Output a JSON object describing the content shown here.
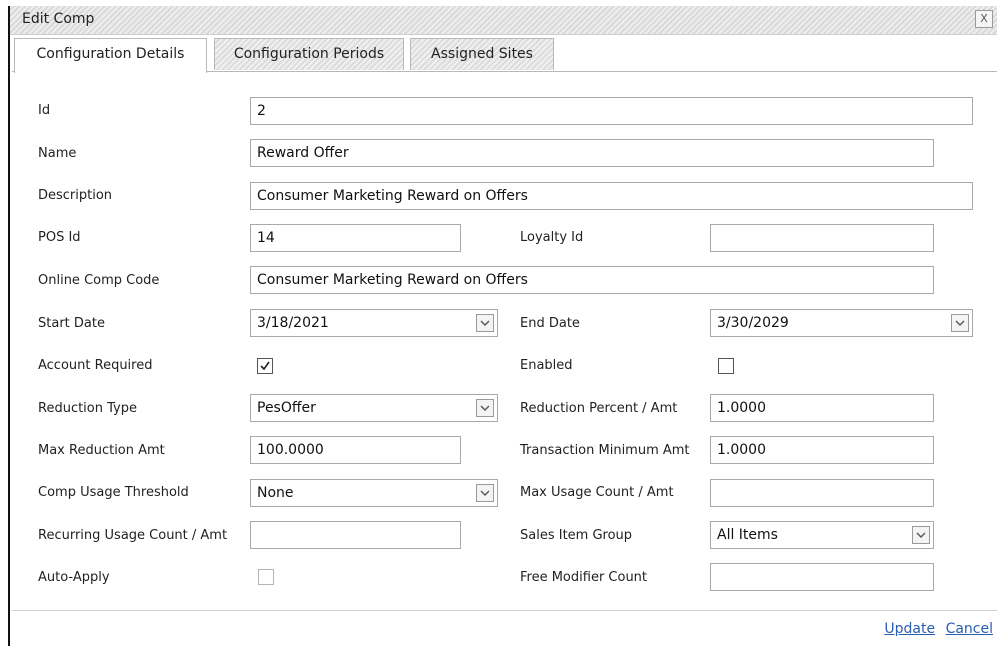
{
  "dialog": {
    "title": "Edit Comp",
    "close_label": "X"
  },
  "tabs": [
    {
      "label": "Configuration Details"
    },
    {
      "label": "Configuration Periods"
    },
    {
      "label": "Assigned Sites"
    }
  ],
  "form": {
    "id": {
      "label": "Id",
      "value": "2"
    },
    "name": {
      "label": "Name",
      "value": "Reward Offer"
    },
    "description": {
      "label": "Description",
      "value": "Consumer Marketing Reward on Offers"
    },
    "pos_id": {
      "label": "POS Id",
      "value": "14"
    },
    "loyalty_id": {
      "label": "Loyalty Id",
      "value": ""
    },
    "online_comp_code": {
      "label": "Online Comp Code",
      "value": "Consumer Marketing Reward on Offers"
    },
    "start_date": {
      "label": "Start Date",
      "value": "3/18/2021"
    },
    "end_date": {
      "label": "End Date",
      "value": "3/30/2029"
    },
    "account_required": {
      "label": "Account Required",
      "checked": true
    },
    "enabled": {
      "label": "Enabled",
      "checked": false
    },
    "reduction_type": {
      "label": "Reduction Type",
      "value": "PesOffer"
    },
    "reduction_percent": {
      "label": "Reduction Percent / Amt",
      "value": "1.0000"
    },
    "max_reduction_amt": {
      "label": "Max Reduction Amt",
      "value": "100.0000"
    },
    "transaction_min_amt": {
      "label": "Transaction Minimum Amt",
      "value": "1.0000"
    },
    "comp_usage_threshold": {
      "label": "Comp Usage Threshold",
      "value": "None"
    },
    "max_usage_count": {
      "label": "Max Usage Count / Amt",
      "value": ""
    },
    "recurring_usage_count": {
      "label": "Recurring Usage Count / Amt",
      "value": ""
    },
    "sales_item_group": {
      "label": "Sales Item Group",
      "value": "All Items"
    },
    "auto_apply": {
      "label": "Auto-Apply",
      "checked": false
    },
    "free_modifier_count": {
      "label": "Free Modifier Count",
      "value": ""
    }
  },
  "footer": {
    "update_label": "Update",
    "cancel_label": "Cancel"
  },
  "colors": {
    "link": "#2a5db0",
    "border": "#a9a9a9"
  }
}
